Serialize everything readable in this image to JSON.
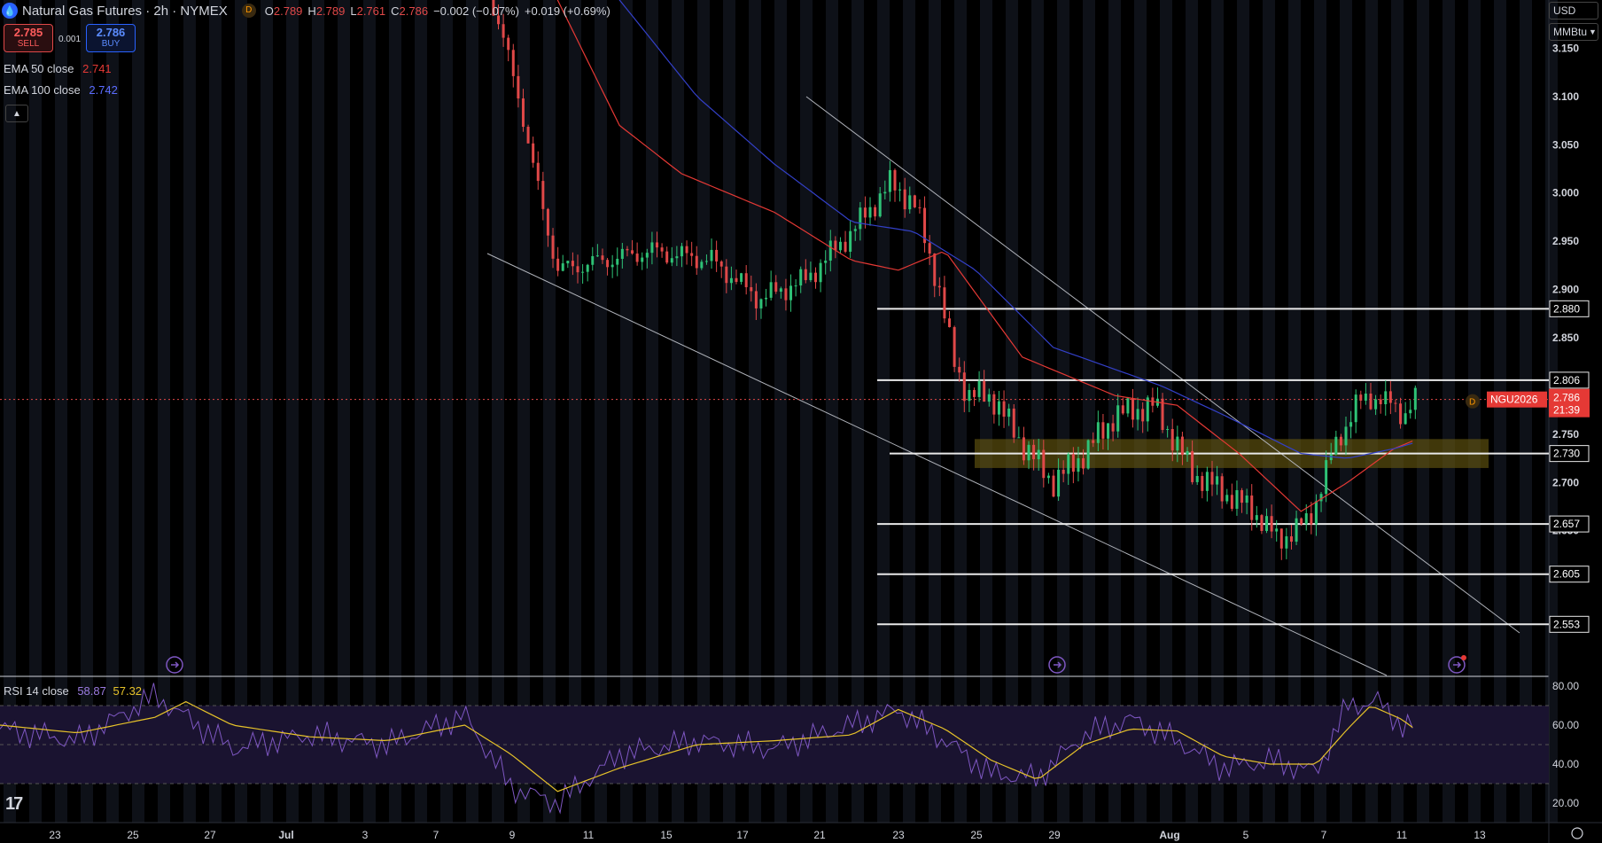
{
  "header": {
    "symbol_title": "Natural Gas Futures · 2h · NYMEX",
    "d_badge": "D",
    "open": "2.789",
    "high": "2.789",
    "low": "2.761",
    "close": "2.786",
    "change": "−0.002 (−0.07%)",
    "change2": "+0.019 (+0.69%)"
  },
  "trade": {
    "sell_price": "2.785",
    "sell_label": "SELL",
    "spread": "0.001",
    "buy_price": "2.786",
    "buy_label": "BUY"
  },
  "indicators": {
    "ema50_label": "EMA 50 close",
    "ema50_value": "2.741",
    "ema100_label": "EMA 100 close",
    "ema100_value": "2.742",
    "collapse_icon": "chevron-up-icon"
  },
  "currency": {
    "selected": "USD",
    "unit": "MMBtu"
  },
  "rsi": {
    "label": "RSI 14 close",
    "value1": "58.87",
    "value2": "57.32"
  },
  "price_axis": {
    "ticks": [
      "3.150",
      "3.100",
      "3.050",
      "3.000",
      "2.950",
      "2.900",
      "2.850",
      "2.750",
      "2.700",
      "2.650"
    ],
    "levels": [
      "2.880",
      "2.806",
      "2.730",
      "2.657",
      "2.605",
      "2.553"
    ],
    "symbol_tag": "NGU2026",
    "last_price": "2.786",
    "countdown": "21:39"
  },
  "rsi_axis": {
    "ticks": [
      "80.00",
      "60.00",
      "40.00",
      "20.00"
    ]
  },
  "time_axis": {
    "labels": [
      "23",
      "25",
      "27",
      "Jul",
      "3",
      "7",
      "9",
      "11",
      "15",
      "17",
      "21",
      "23",
      "25",
      "29",
      "Aug",
      "5",
      "7",
      "11",
      "13"
    ],
    "last_icon": "settings-gear-icon"
  },
  "colors": {
    "background": "#000000",
    "candle_up": "#2ec276",
    "candle_down": "#e04848",
    "ema50": "#e53935",
    "ema100": "#3340c8",
    "rsi_line": "#7e57c2",
    "rsi_ma": "#e6c229",
    "zone": "#6b5b10"
  },
  "chart_data": {
    "type": "candlestick",
    "y_range": [
      2.5,
      3.2
    ],
    "rsi_range": [
      10,
      85
    ],
    "horizontal_levels": [
      2.88,
      2.806,
      2.73,
      2.657,
      2.605,
      2.553
    ],
    "support_zone": [
      2.715,
      2.745
    ],
    "path": [
      [
        0.0,
        3.3
      ],
      [
        0.3,
        3.3
      ],
      [
        0.335,
        3.1
      ],
      [
        0.345,
        3.02
      ],
      [
        0.36,
        2.92
      ],
      [
        0.39,
        2.93
      ],
      [
        0.42,
        2.94
      ],
      [
        0.46,
        2.93
      ],
      [
        0.49,
        2.89
      ],
      [
        0.52,
        2.91
      ],
      [
        0.55,
        2.96
      ],
      [
        0.575,
        3.01
      ],
      [
        0.59,
        2.99
      ],
      [
        0.605,
        2.91
      ],
      [
        0.615,
        2.83
      ],
      [
        0.625,
        2.79
      ],
      [
        0.64,
        2.79
      ],
      [
        0.66,
        2.74
      ],
      [
        0.68,
        2.7
      ],
      [
        0.7,
        2.73
      ],
      [
        0.72,
        2.77
      ],
      [
        0.745,
        2.78
      ],
      [
        0.77,
        2.71
      ],
      [
        0.79,
        2.69
      ],
      [
        0.81,
        2.67
      ],
      [
        0.825,
        2.64
      ],
      [
        0.845,
        2.66
      ],
      [
        0.86,
        2.73
      ],
      [
        0.875,
        2.78
      ],
      [
        0.89,
        2.79
      ],
      [
        0.905,
        2.77
      ],
      [
        0.915,
        2.79
      ]
    ],
    "ema50": [
      [
        0.0,
        3.3
      ],
      [
        0.33,
        3.3
      ],
      [
        0.36,
        3.2
      ],
      [
        0.4,
        3.07
      ],
      [
        0.44,
        3.02
      ],
      [
        0.5,
        2.98
      ],
      [
        0.55,
        2.93
      ],
      [
        0.58,
        2.92
      ],
      [
        0.61,
        2.94
      ],
      [
        0.66,
        2.83
      ],
      [
        0.72,
        2.79
      ],
      [
        0.76,
        2.78
      ],
      [
        0.8,
        2.73
      ],
      [
        0.84,
        2.67
      ],
      [
        0.87,
        2.7
      ],
      [
        0.9,
        2.735
      ],
      [
        0.915,
        2.745
      ]
    ],
    "ema100": [
      [
        0.0,
        3.3
      ],
      [
        0.36,
        3.3
      ],
      [
        0.4,
        3.2
      ],
      [
        0.45,
        3.1
      ],
      [
        0.5,
        3.03
      ],
      [
        0.55,
        2.97
      ],
      [
        0.59,
        2.96
      ],
      [
        0.63,
        2.92
      ],
      [
        0.68,
        2.84
      ],
      [
        0.75,
        2.8
      ],
      [
        0.79,
        2.77
      ],
      [
        0.84,
        2.73
      ],
      [
        0.87,
        2.725
      ],
      [
        0.9,
        2.735
      ],
      [
        0.915,
        2.742
      ]
    ],
    "rsi": [
      [
        0.0,
        58
      ],
      [
        0.05,
        52
      ],
      [
        0.1,
        75
      ],
      [
        0.15,
        48
      ],
      [
        0.2,
        55
      ],
      [
        0.25,
        50
      ],
      [
        0.3,
        65
      ],
      [
        0.33,
        28
      ],
      [
        0.36,
        20
      ],
      [
        0.4,
        45
      ],
      [
        0.45,
        52
      ],
      [
        0.5,
        48
      ],
      [
        0.55,
        60
      ],
      [
        0.58,
        68
      ],
      [
        0.61,
        52
      ],
      [
        0.64,
        35
      ],
      [
        0.67,
        33
      ],
      [
        0.7,
        55
      ],
      [
        0.73,
        63
      ],
      [
        0.76,
        52
      ],
      [
        0.79,
        38
      ],
      [
        0.82,
        42
      ],
      [
        0.85,
        36
      ],
      [
        0.87,
        70
      ],
      [
        0.89,
        72
      ],
      [
        0.905,
        60
      ],
      [
        0.915,
        59
      ]
    ],
    "rsi_ma": [
      [
        0.0,
        60
      ],
      [
        0.05,
        56
      ],
      [
        0.1,
        64
      ],
      [
        0.12,
        72
      ],
      [
        0.15,
        60
      ],
      [
        0.2,
        54
      ],
      [
        0.25,
        52
      ],
      [
        0.3,
        60
      ],
      [
        0.33,
        45
      ],
      [
        0.36,
        26
      ],
      [
        0.4,
        38
      ],
      [
        0.45,
        50
      ],
      [
        0.5,
        52
      ],
      [
        0.55,
        55
      ],
      [
        0.58,
        68
      ],
      [
        0.61,
        58
      ],
      [
        0.64,
        42
      ],
      [
        0.67,
        32
      ],
      [
        0.7,
        50
      ],
      [
        0.73,
        58
      ],
      [
        0.76,
        57
      ],
      [
        0.79,
        44
      ],
      [
        0.82,
        40
      ],
      [
        0.85,
        40
      ],
      [
        0.87,
        58
      ],
      [
        0.885,
        70
      ],
      [
        0.905,
        63
      ],
      [
        0.915,
        57
      ]
    ]
  }
}
